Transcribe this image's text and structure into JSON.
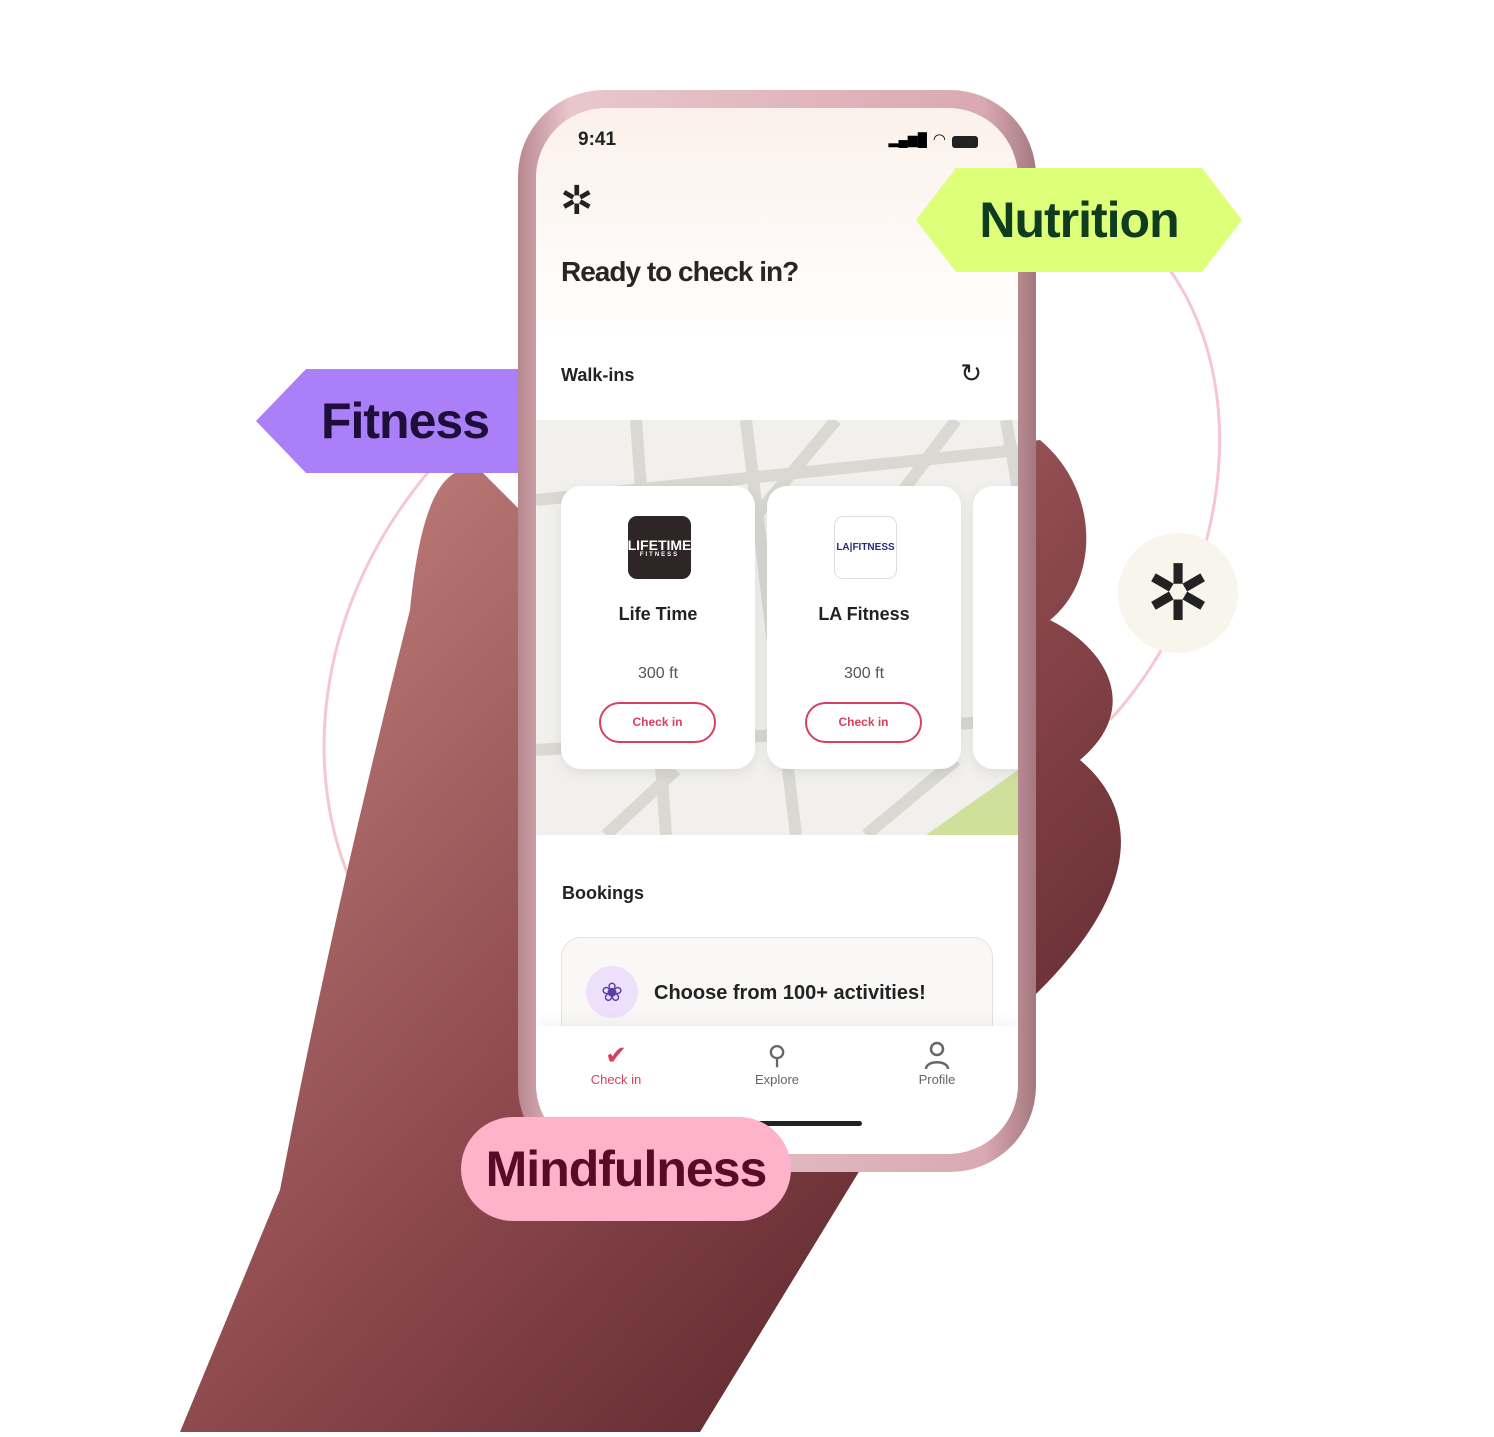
{
  "status_bar": {
    "time": "9:41"
  },
  "header": {
    "title": "Ready to check in?",
    "logo_icon": "pinwheel-icon"
  },
  "walkins": {
    "label": "Walk-ins",
    "refresh_icon": "refresh-icon",
    "cards": [
      {
        "name": "Life Time",
        "logo": "LIFETIME",
        "logo_sub": "FITNESS",
        "distance": "300 ft",
        "button": "Check in"
      },
      {
        "name": "LA Fitness",
        "logo": "LA|FITNESS",
        "distance": "300 ft",
        "button": "Check in"
      }
    ]
  },
  "bookings": {
    "label": "Bookings",
    "card_text": "Choose from 100+ activities!",
    "card_icon": "lotus-icon"
  },
  "nav": {
    "items": [
      {
        "label": "Check in",
        "icon": "location-check-icon",
        "active": true
      },
      {
        "label": "Explore",
        "icon": "search-icon"
      },
      {
        "label": "Profile",
        "icon": "user-icon"
      }
    ]
  },
  "tags": {
    "fitness": "Fitness",
    "nutrition": "Nutrition",
    "mindfulness": "Mindfulness"
  },
  "colors": {
    "accent": "#d9405f",
    "fitness": "#ab7ff8",
    "nutrition": "#ddff7a",
    "mindfulness": "#ffb3cb"
  }
}
